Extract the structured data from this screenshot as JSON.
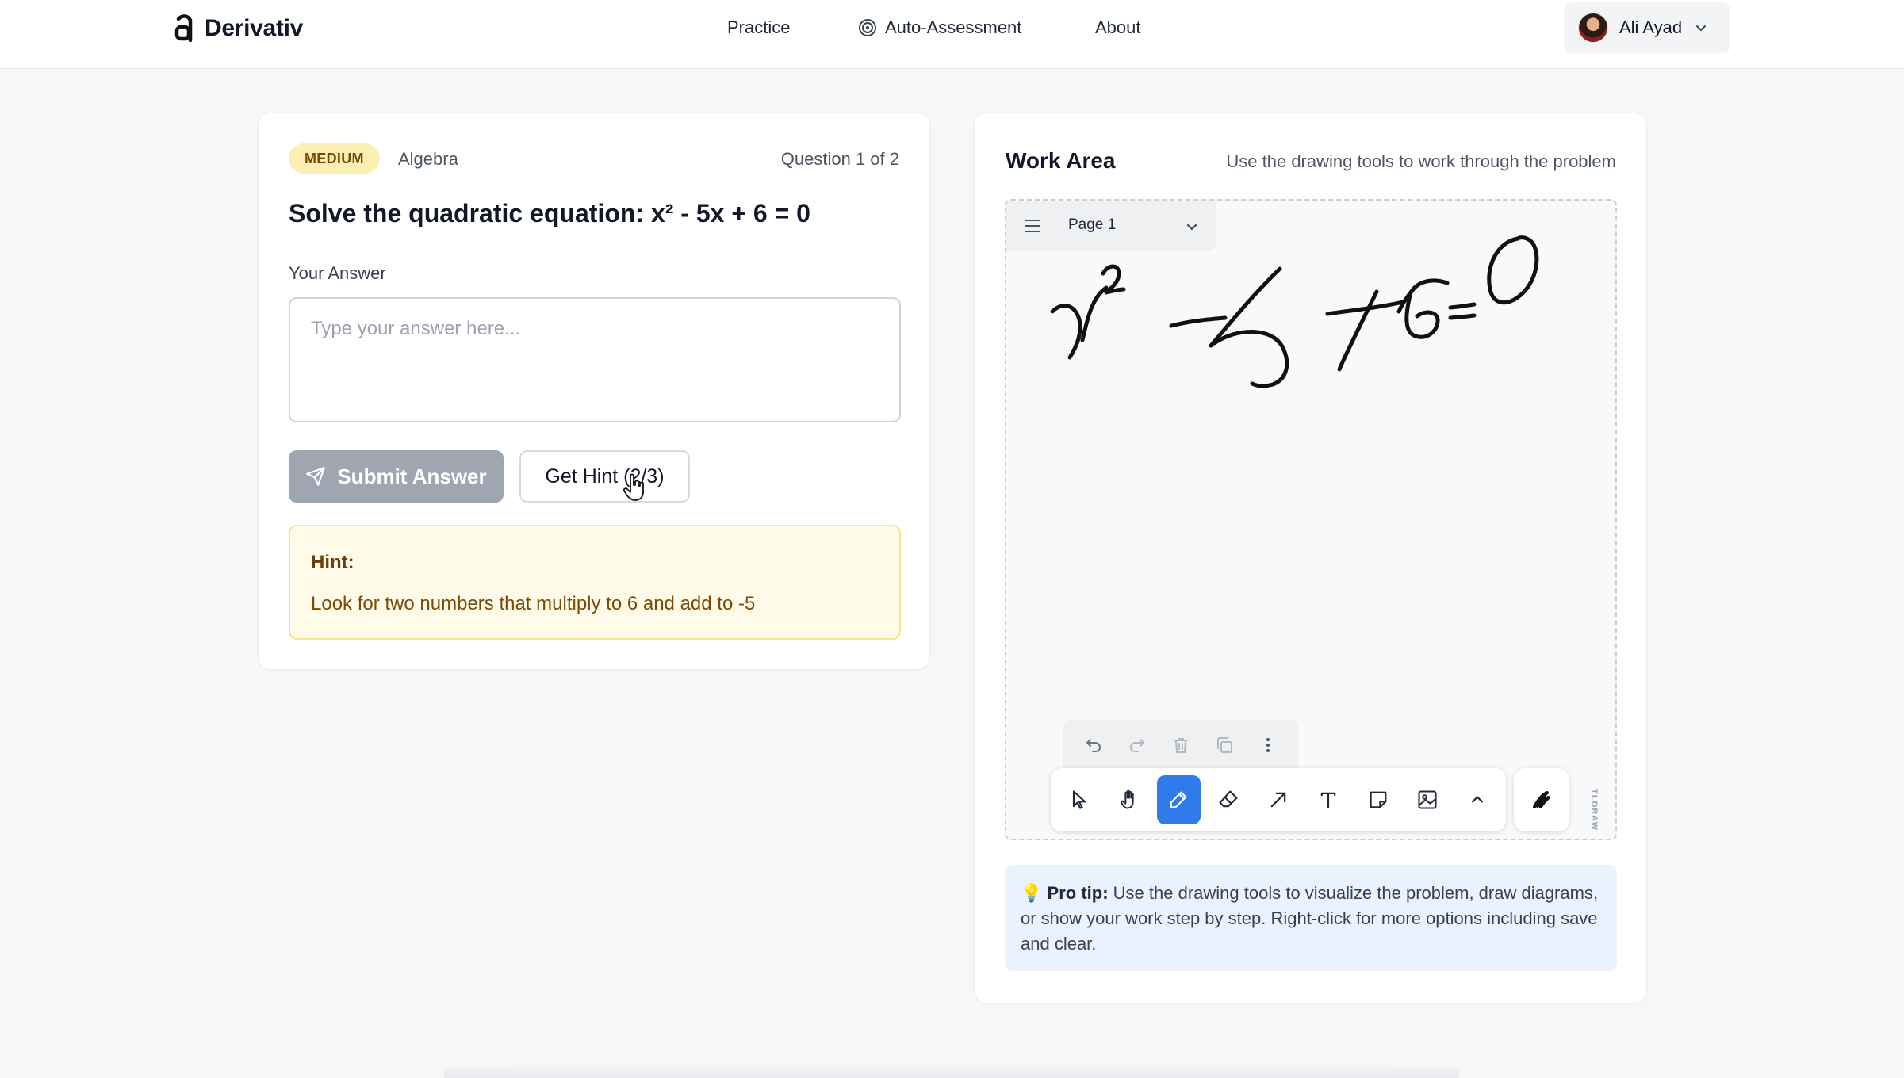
{
  "brand": {
    "name": "Derivativ"
  },
  "nav": {
    "items": [
      {
        "label": "Practice"
      },
      {
        "label": "Auto-Assessment",
        "icon": "target-icon"
      },
      {
        "label": "About"
      }
    ]
  },
  "user": {
    "name": "Ali Ayad"
  },
  "question_card": {
    "difficulty": "MEDIUM",
    "topic": "Algebra",
    "counter": "Question 1 of 2",
    "question": "Solve the quadratic equation: x² - 5x + 6 = 0",
    "answer_label": "Your Answer",
    "answer_placeholder": "Type your answer here...",
    "answer_value": "",
    "submit_label": "Submit Answer",
    "hint_button_label": "Get Hint (2/3)",
    "hint_title": "Hint:",
    "hint_text": "Look for two numbers that multiply to 6 and add to -5"
  },
  "work_area": {
    "title": "Work Area",
    "subtitle": "Use the drawing tools to work through the problem",
    "page_label": "Page 1",
    "active_tool": "draw",
    "tools": [
      "select-icon",
      "hand-icon",
      "pencil-icon",
      "eraser-icon",
      "arrow-icon",
      "text-icon",
      "note-icon",
      "image-icon",
      "chevron-up-icon"
    ],
    "edit_actions": [
      "undo-icon",
      "redo-icon",
      "trash-icon",
      "duplicate-icon",
      "more-icon"
    ],
    "watermark": "TLDRAW",
    "pro_tip_label": "Pro tip:",
    "pro_tip_text": "Use the drawing tools to visualize the problem, draw diagrams, or show your work step by step. Right-click for more options including save and clear."
  },
  "colors": {
    "accent": "#2f7bea",
    "badge_bg": "#fcefb4",
    "hint_bg": "#fffbe8",
    "tip_bg": "#eaf2fe"
  }
}
